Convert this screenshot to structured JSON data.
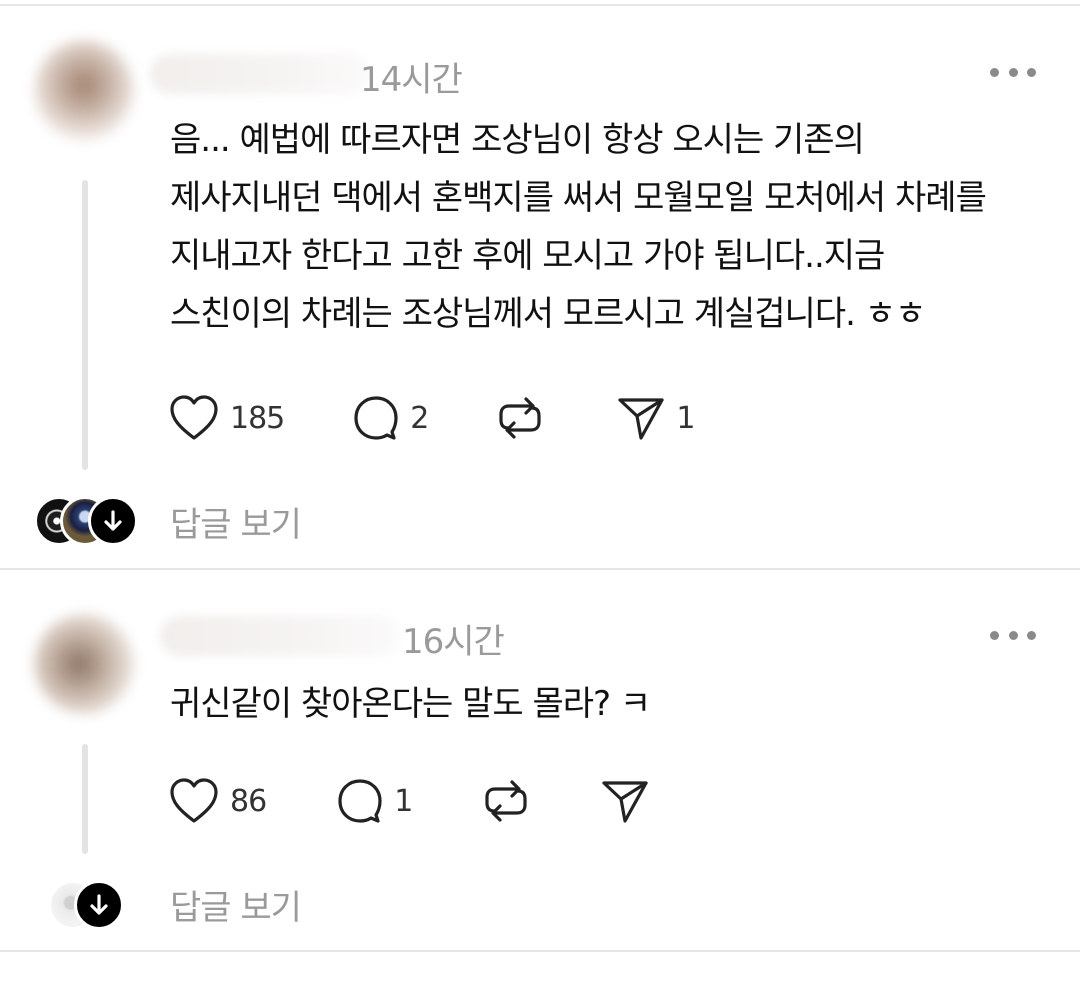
{
  "comments": [
    {
      "time": "14시간",
      "lines": [
        "음... 예법에 따르자면 조상님이 항상 오시는  기존의",
        "제사지내던 댁에서 혼백지를 써서 모월모일 모처에서 차례를",
        "지내고자 한다고 고한 후에 모시고 가야 됩니다..지금",
        "스친이의 차례는 조상님께서 모르시고 계실겁니다. ㅎㅎ"
      ],
      "likes": "185",
      "replies": "2",
      "reposts": "",
      "shares": "1",
      "view_replies": "답글 보기",
      "icons": {
        "more": "more-icon",
        "like": "heart-icon",
        "reply": "comment-icon",
        "repost": "repost-icon",
        "share": "send-icon",
        "expand": "arrow-down-icon"
      }
    },
    {
      "time": "16시간",
      "lines": [
        "귀신같이 찾아온다는 말도 몰라? ㅋ"
      ],
      "likes": "86",
      "replies": "1",
      "reposts": "",
      "shares": "",
      "view_replies": "답글 보기",
      "icons": {
        "more": "more-icon",
        "like": "heart-icon",
        "reply": "comment-icon",
        "repost": "repost-icon",
        "share": "send-icon",
        "expand": "arrow-down-icon"
      }
    }
  ],
  "colors": {
    "text": "#111111",
    "muted": "#9a9a9a",
    "divider": "#e6e6e6",
    "icon": "#222222"
  }
}
